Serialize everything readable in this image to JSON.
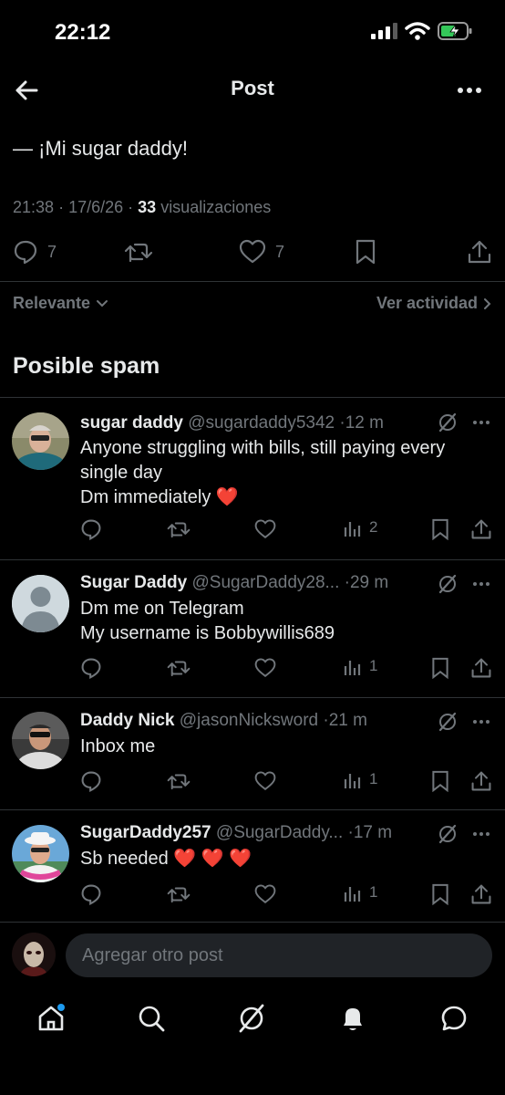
{
  "status_bar": {
    "time": "22:12"
  },
  "header": {
    "title": "Post"
  },
  "post": {
    "text": "— ¡Mi sugar daddy!",
    "time": "21:38",
    "date": "17/6/26",
    "views_count": "33",
    "views_label": "visualizaciones",
    "replies": "7",
    "likes": "7"
  },
  "sort": {
    "left_label": "Relevante",
    "right_label": "Ver actividad"
  },
  "section": {
    "title": "Posible spam"
  },
  "replies": [
    {
      "name": "sugar daddy",
      "handle": "@sugardaddy5342",
      "time": "12 m",
      "text_lines": [
        "Anyone struggling with bills,  still paying every",
        "single day",
        "Dm immediately ❤️"
      ],
      "views": "2"
    },
    {
      "name": "Sugar Daddy",
      "handle": "@SugarDaddy28...",
      "time": "29 m",
      "text_lines": [
        "Dm me on Telegram",
        "My username is Bobbywillis689"
      ],
      "views": "1"
    },
    {
      "name": "Daddy Nick",
      "handle": "@jasonNicksword",
      "time": "21 m",
      "text_lines": [
        "Inbox me"
      ],
      "views": "1"
    },
    {
      "name": "SugarDaddy257",
      "handle": "@SugarDaddy...",
      "time": "17 m",
      "text_lines": [
        "Sb needed ❤️ ❤️ ❤️"
      ],
      "views": "1"
    }
  ],
  "compose": {
    "placeholder": "Agregar otro post"
  },
  "colors": {
    "background": "#000000",
    "text": "#e7e9ea",
    "muted": "#71767b",
    "accent": "#1d9bf0",
    "battery": "#34c759"
  }
}
